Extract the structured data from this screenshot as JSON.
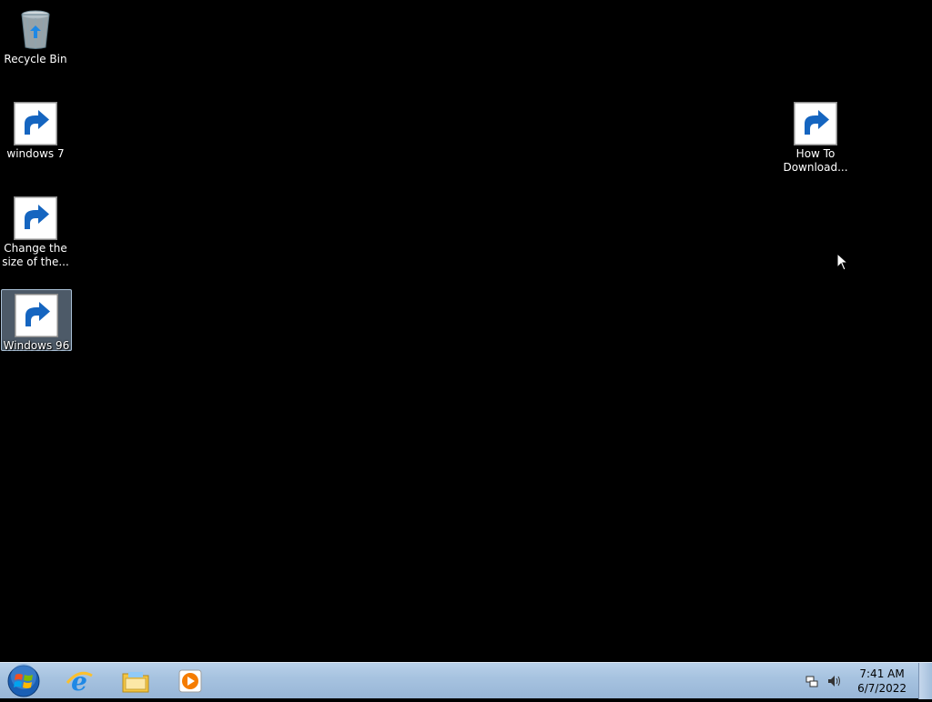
{
  "desktop": {
    "icons": [
      {
        "label": "Recycle Bin",
        "icon": "recycle-bin-icon"
      },
      {
        "label": "windows 7",
        "icon": "windows-logo-icon"
      },
      {
        "label": "Change the size of the...",
        "icon": "display-settings-icon"
      },
      {
        "label": "Windows 96",
        "icon": "windows-96-icon",
        "selected": true
      },
      {
        "label": "How To Download...",
        "icon": "internet-explorer-document-icon"
      }
    ]
  },
  "taskbar": {
    "start": "start-button",
    "pinned": [
      "internet-explorer-icon",
      "file-explorer-icon",
      "media-player-icon"
    ],
    "tray": {
      "icons": [
        "network-icon",
        "volume-icon"
      ],
      "time": "7:41 AM",
      "date": "6/7/2022"
    }
  },
  "colors": {
    "desktop_background": "#000000",
    "taskbar": "#a7c3e0",
    "selection": "#aac8e6"
  }
}
